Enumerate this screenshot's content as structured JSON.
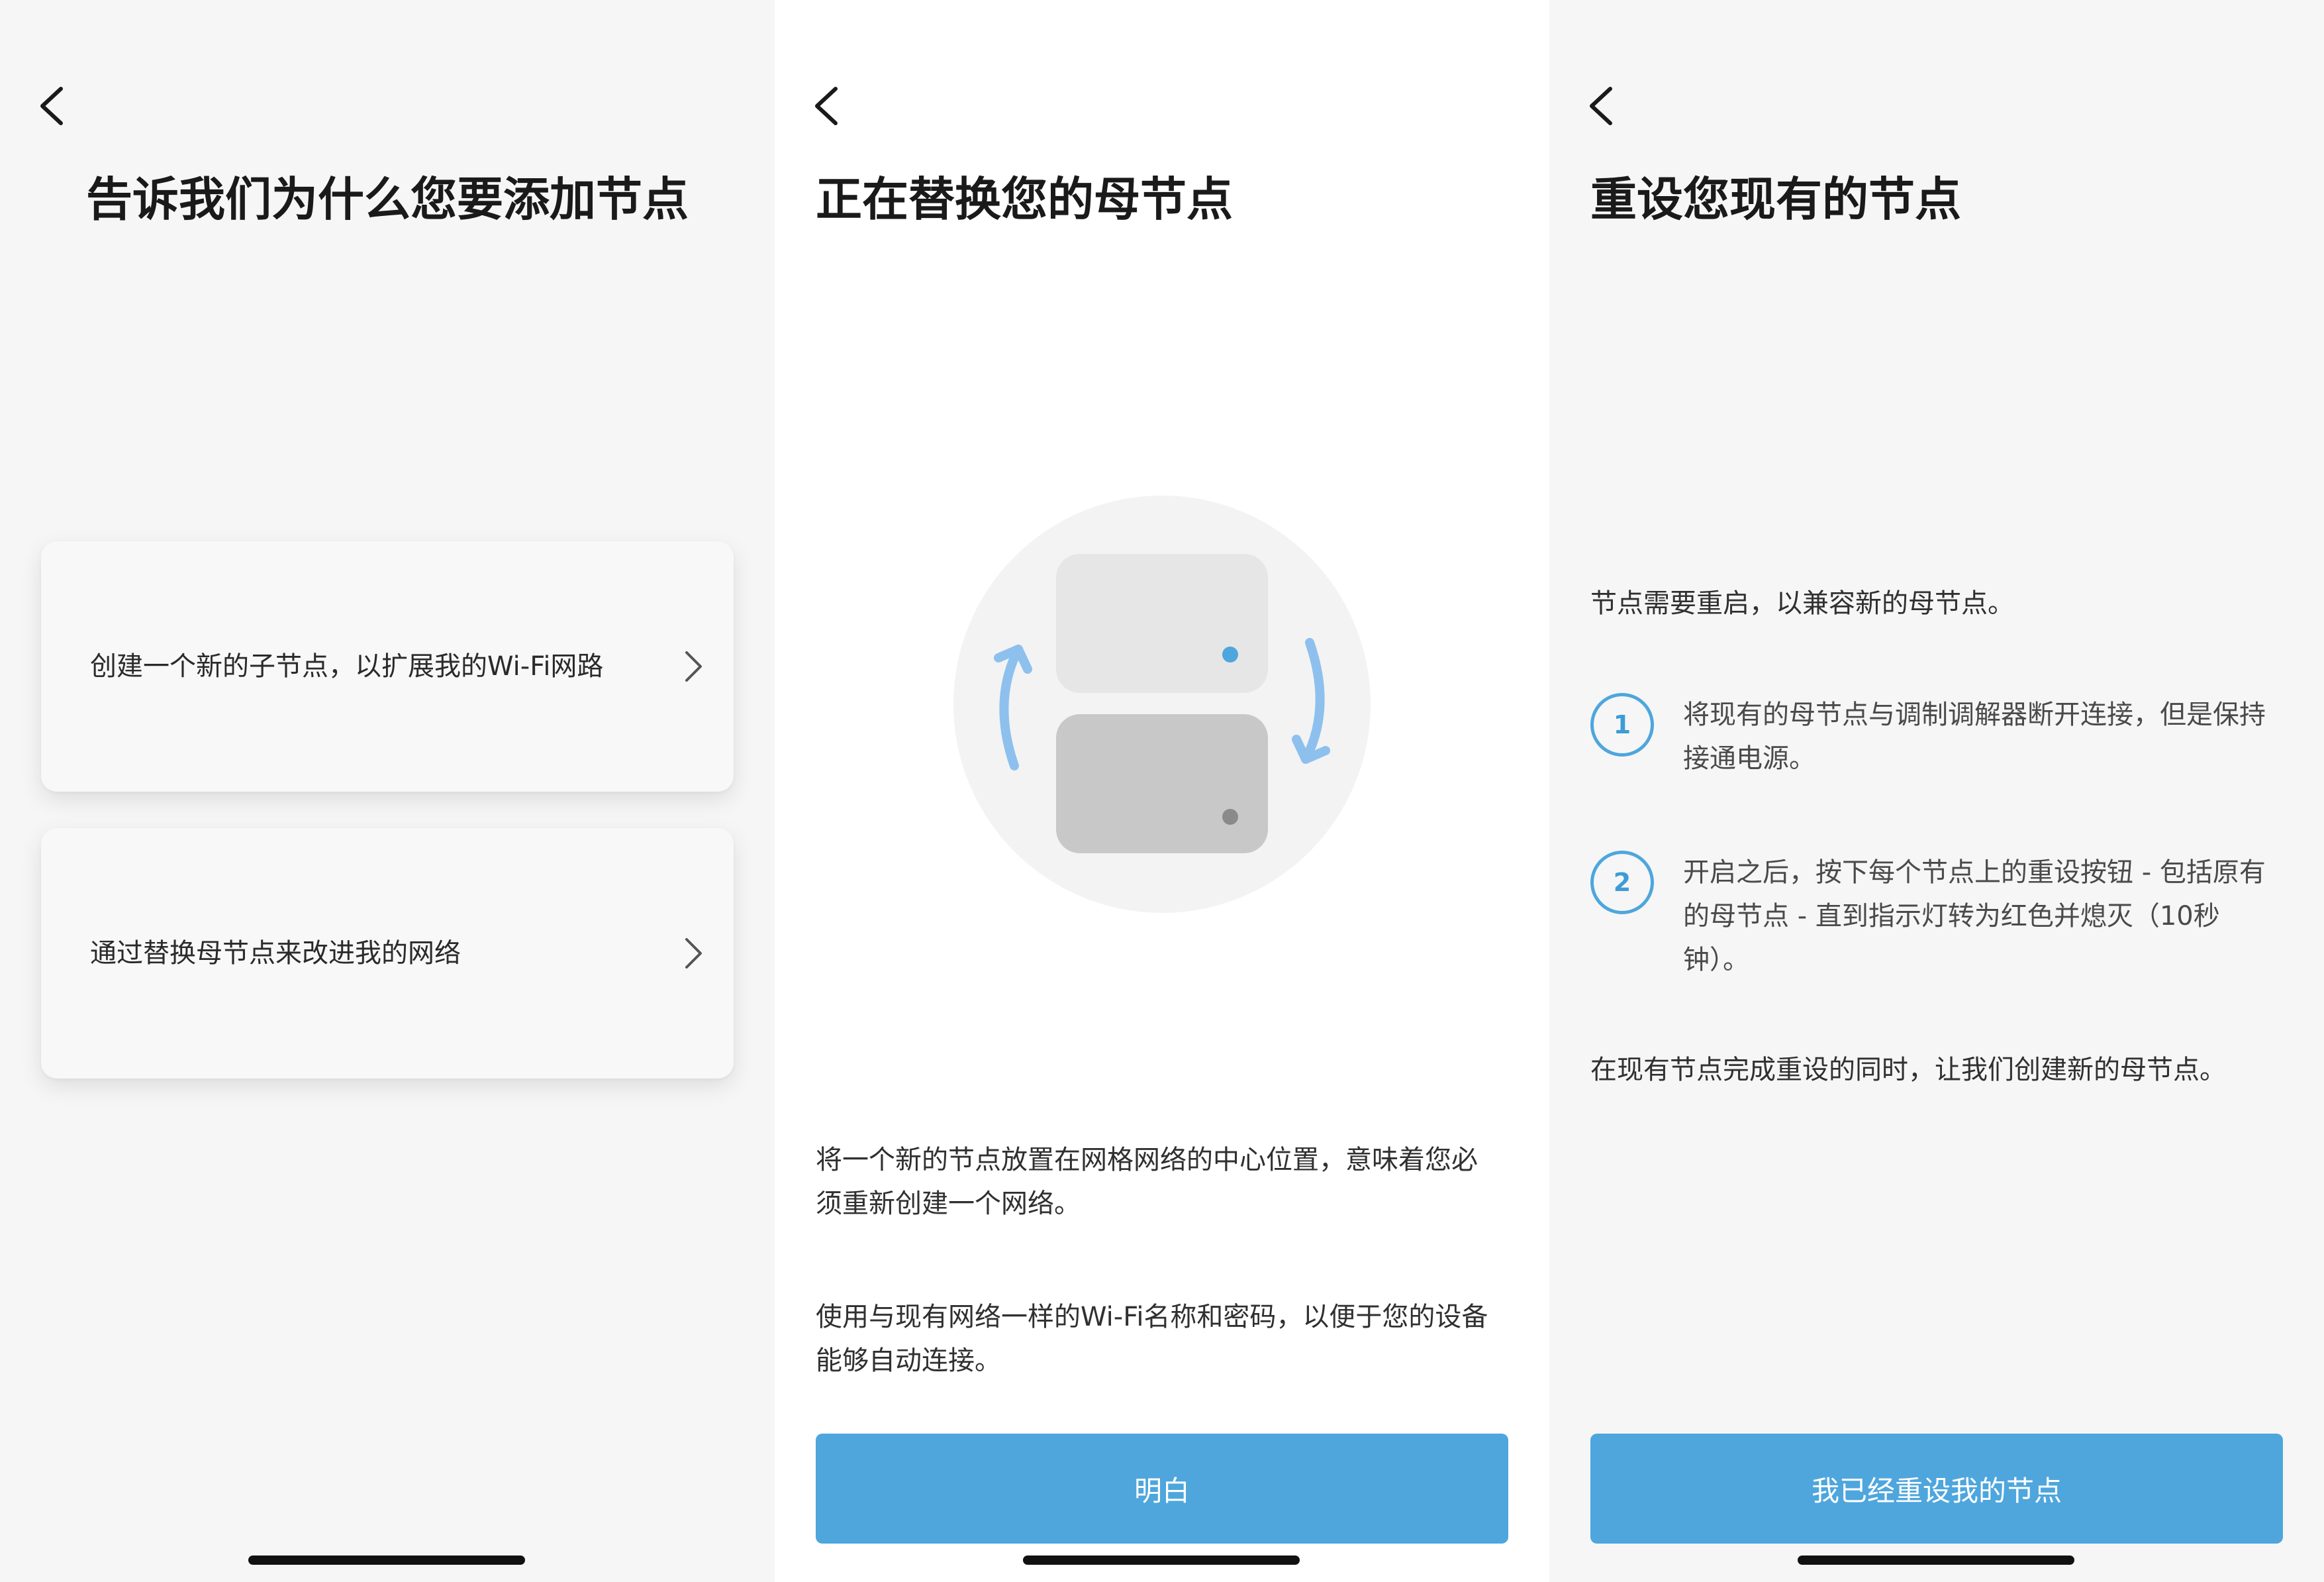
{
  "colors": {
    "accent": "#4ea6dd",
    "screen_bg": "#f6f6f6",
    "card_bg": "#f8f8f8",
    "text": "#1f1f1f"
  },
  "screen1": {
    "back_icon": "chevron-left-icon",
    "title": "告诉我们为什么您要添加节点",
    "options": [
      {
        "label": "创建一个新的子节点，以扩展我的Wi-Fi网路",
        "icon": "chevron-right-icon"
      },
      {
        "label": "通过替换母节点来改进我的网络",
        "icon": "chevron-right-icon"
      }
    ]
  },
  "screen2": {
    "back_icon": "chevron-left-icon",
    "title": "正在替换您的母节点",
    "illustration": "node-swap-illustration",
    "paragraphs": [
      "将一个新的节点放置在网格网络的中心位置，意味着您必须重新创建一个网络。",
      "使用与现有网络一样的Wi-Fi名称和密码，以便于您的设备能够自动连接。"
    ],
    "button_label": "明白"
  },
  "screen3": {
    "back_icon": "chevron-left-icon",
    "title": "重设您现有的节点",
    "intro": "节点需要重启，以兼容新的母节点。",
    "steps": [
      {
        "number": "1",
        "text": "将现有的母节点与调制调解器断开连接，但是保持接通电源。"
      },
      {
        "number": "2",
        "text": "开启之后，按下每个节点上的重设按钮 - 包括原有的母节点 - 直到指示灯转为红色并熄灭（10秒钟）。"
      }
    ],
    "outro": "在现有节点完成重设的同时，让我们创建新的母节点。",
    "button_label": "我已经重设我的节点"
  }
}
